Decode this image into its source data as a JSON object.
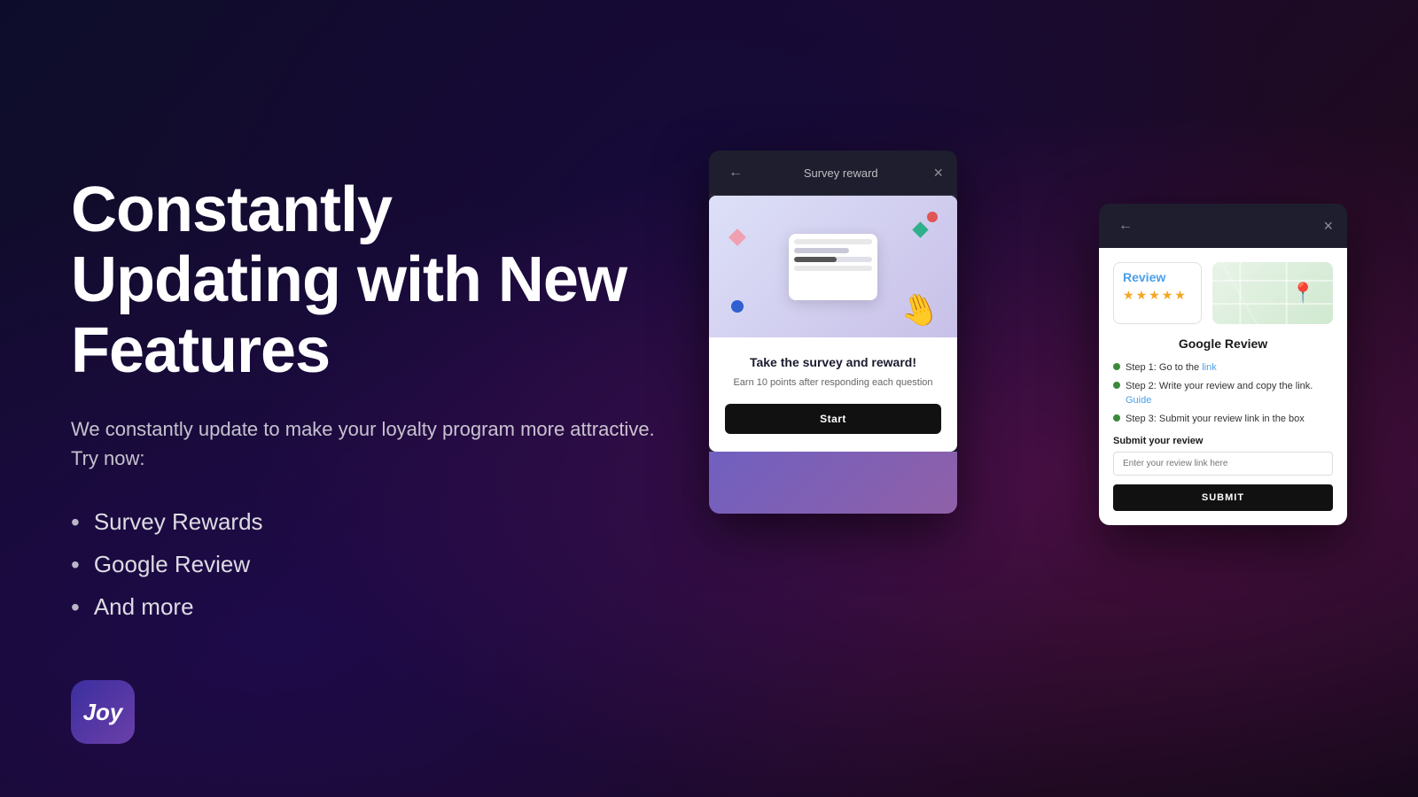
{
  "page": {
    "background": "#0a0a1a"
  },
  "hero": {
    "title": "Constantly Updating with New Features",
    "subtitle": "We constantly update to make your loyalty program more attractive. Try now:",
    "bullet_items": [
      "Survey Rewards",
      "Google Review",
      "And more"
    ]
  },
  "logo": {
    "text": "Joy"
  },
  "survey_modal": {
    "header_title": "Survey reward",
    "back_icon": "←",
    "close_icon": "×",
    "card": {
      "title": "Take the survey and reward!",
      "description": "Earn 10 points after responding each question",
      "start_button": "Start"
    }
  },
  "review_modal": {
    "back_icon": "←",
    "close_icon": "×",
    "card": {
      "review_label": "Review",
      "stars": [
        "★",
        "★",
        "★",
        "★",
        "★"
      ],
      "title": "Google Review",
      "step1_text": "Step 1: Go to the ",
      "step1_link": "link",
      "step2_text": "Step 2: Write your review and copy the link. ",
      "step2_link": "Guide",
      "step3_text": "Step 3: Submit your review link in the box",
      "submit_label": "Submit your review",
      "input_placeholder": "Enter your review link here",
      "submit_button": "SUBMIT"
    }
  }
}
